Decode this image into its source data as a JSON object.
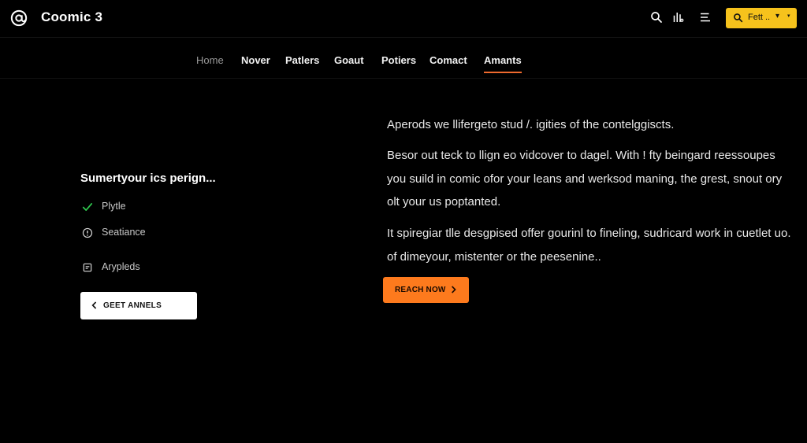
{
  "header": {
    "app_title": "Coomic 3",
    "logo_icon": "at-sign-icon",
    "icons": [
      "search-icon",
      "stats-icon",
      "menu-icon"
    ],
    "cta_label": "Fett ..",
    "cta_caret": "▾",
    "cta_caret2": "▾",
    "accent_color": "#f6c21c"
  },
  "nav": {
    "items": [
      {
        "label": "Home",
        "active": false
      },
      {
        "label": "Nover",
        "active": false
      },
      {
        "label": "Patlers",
        "active": false
      },
      {
        "label": "Goaut",
        "active": false
      },
      {
        "label": "Potiers",
        "active": false
      },
      {
        "label": "Comact",
        "active": false
      },
      {
        "label": "Amants",
        "active": true
      }
    ],
    "underline_color": "#ef6a2e"
  },
  "left": {
    "heading": "Sumertyour ics perign...",
    "features": [
      {
        "label": "Plytle",
        "icon": "check-icon"
      },
      {
        "label": "Seatiance",
        "icon": "info-circle-icon"
      },
      {
        "label": "Arypleds",
        "icon": "document-icon"
      }
    ],
    "button_label": "GEET ANNELS",
    "button_icon": "chevron-left-icon"
  },
  "right": {
    "paragraphs": [
      "Aperods we llifergeto stud /. igities of the contelggiscts.",
      "Besor out teck to llign eo vidcover to dagel. With ! fty beingard reessoupes you suild in comic ofor your leans and werksod maning, the grest, snout ory olt your us poptanted.",
      "It spiregiar tlle desgpised offer gourinl to fineling, sudricard work in cuetlet uo. of dimeyour, mistenter or the peesenine.."
    ],
    "button_label": "REACH NOW",
    "button_icon": "chevron-right-icon",
    "button_color": "#fd7a1d"
  }
}
